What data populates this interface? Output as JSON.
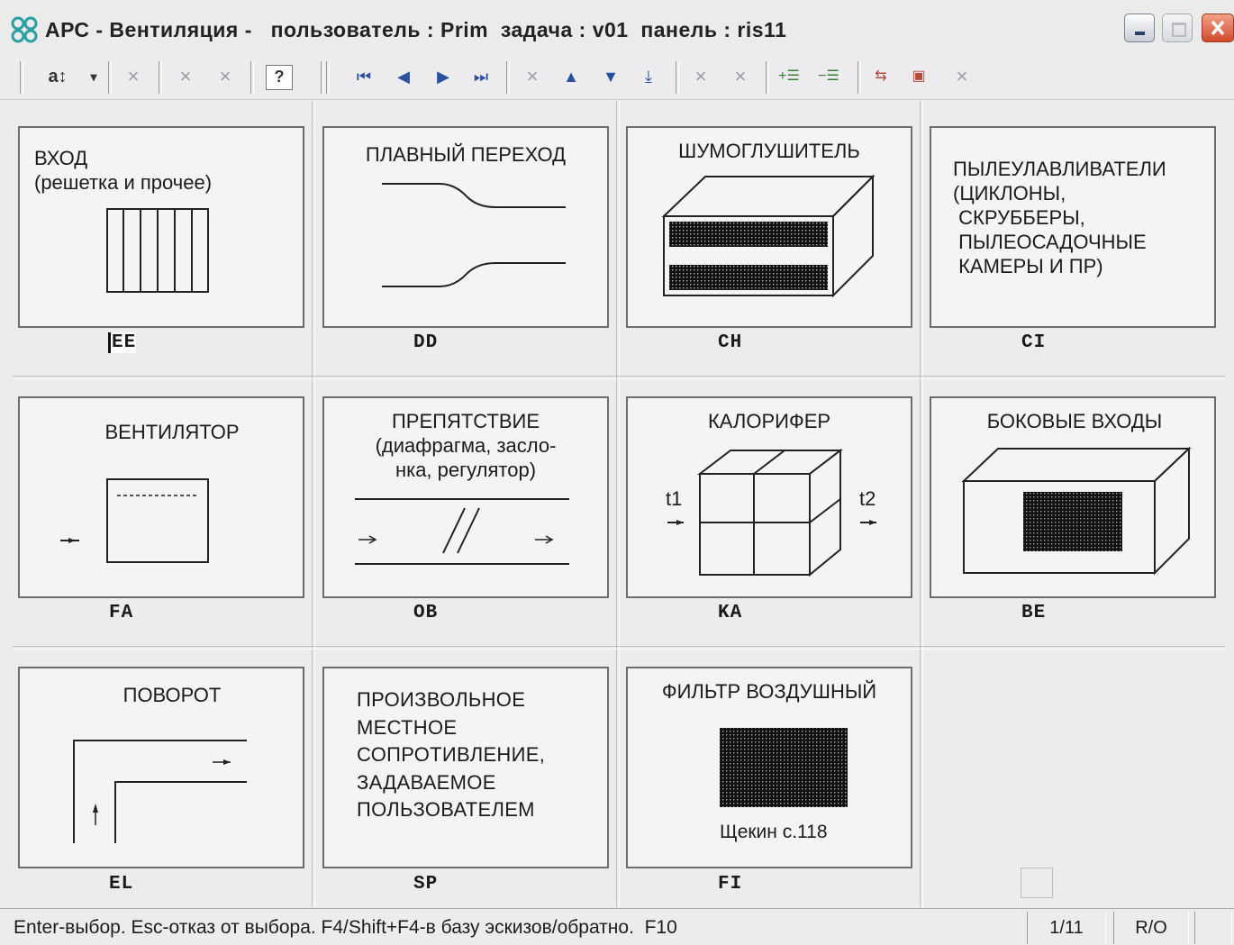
{
  "window": {
    "title": "АРС - Вентиляция -   пользователь : Prim  задача : v01  панель : ris11"
  },
  "toolbar": {
    "sort_label": "a↕",
    "dropdown_glyph": "▾",
    "disabled_glyph": "×",
    "help_label": "?",
    "nav_first": "⏮",
    "nav_prev": "◀",
    "nav_next": "▶",
    "nav_last": "⏭",
    "up": "▲",
    "down": "▼",
    "bottom": "⤓",
    "add_row": "+☰",
    "remove_row": "−☰",
    "tool_a": "⇆",
    "tool_b": "▣"
  },
  "cards": [
    {
      "code": "EE",
      "text": "ВХОД\n(решетка и прочее)"
    },
    {
      "code": "DD",
      "text": "ПЛАВНЫЙ ПЕРЕХОД"
    },
    {
      "code": "CH",
      "text": "ШУМОГЛУШИТЕЛЬ"
    },
    {
      "code": "CI",
      "text": "ПЫЛЕУЛАВЛИВАТЕЛИ\n(ЦИКЛОНЫ,\n СКРУББЕРЫ,\n ПЫЛЕОСАДОЧНЫЕ\n КАМЕРЫ И ПР)"
    },
    {
      "code": "FA",
      "text": "ВЕНТИЛЯТОР"
    },
    {
      "code": "OB",
      "text": "ПРЕПЯТСТВИЕ\n(диафрагма, засло-\nнка, регулятор)"
    },
    {
      "code": "KA",
      "text": "КАЛОРИФЕР",
      "t1": "t1",
      "t2": "t2"
    },
    {
      "code": "BE",
      "text": "БОКОВЫЕ ВХОДЫ"
    },
    {
      "code": "EL",
      "text": "ПОВОРОТ"
    },
    {
      "code": "SP",
      "text": "ПРОИЗВОЛЬНОЕ\nМЕСТНОЕ\nСОПРОТИВЛЕНИЕ,\nЗАДАВАЕМОЕ\nПОЛЬЗОВАТЕЛЕМ"
    },
    {
      "code": "FI",
      "text": "ФИЛЬТР ВОЗДУШНЫЙ",
      "note": "Щекин с.118"
    }
  ],
  "status": {
    "hint": "Enter-выбор. Esc-отказ от выбора. F4/Shift+F4-в базу эскизов/обратно.  F10",
    "page": "1/11",
    "mode": "R/O"
  }
}
